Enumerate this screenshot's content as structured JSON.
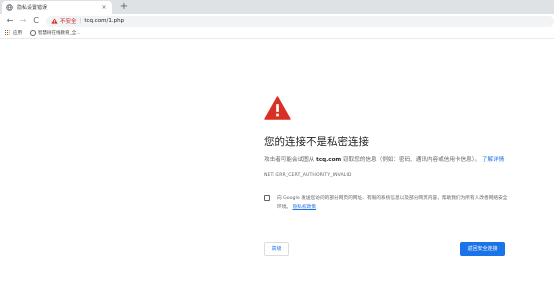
{
  "tab": {
    "title": "隐私设置错误",
    "close": "×",
    "new_tab": "+"
  },
  "toolbar": {
    "back": "←",
    "forward": "→",
    "reload": "C",
    "not_secure": "不安全",
    "separator": "|",
    "url": "tcq.com/1.php"
  },
  "bookmarks": {
    "items": [
      {
        "label": "应用",
        "icon": "apps-grid-icon"
      },
      {
        "label": "智慧树在线教育_全...",
        "icon": "globe-icon"
      }
    ]
  },
  "interstitial": {
    "heading": "您的连接不是私密连接",
    "desc_prefix": "攻击者可能会试图从",
    "desc_domain": "tcq.com",
    "desc_suffix": "窃取您的信息（例如：密码、通讯内容或信用卡信息）。",
    "learn_more": "了解详情",
    "error_code": "NET::ERR_CERT_AUTHORITY_INVALID",
    "optin_text": "向 Google 发送您访问的部分网页的网址、有限的系统信息以及部分网页内容，帮助我们为所有人改善网络安全环境。",
    "privacy_link": "隐私权政策",
    "details_button": "高级",
    "back_button": "返回安全连接"
  },
  "colors": {
    "accent": "#1a73e8",
    "warning_red": "#d93025",
    "not_secure_red": "#c5221f"
  }
}
